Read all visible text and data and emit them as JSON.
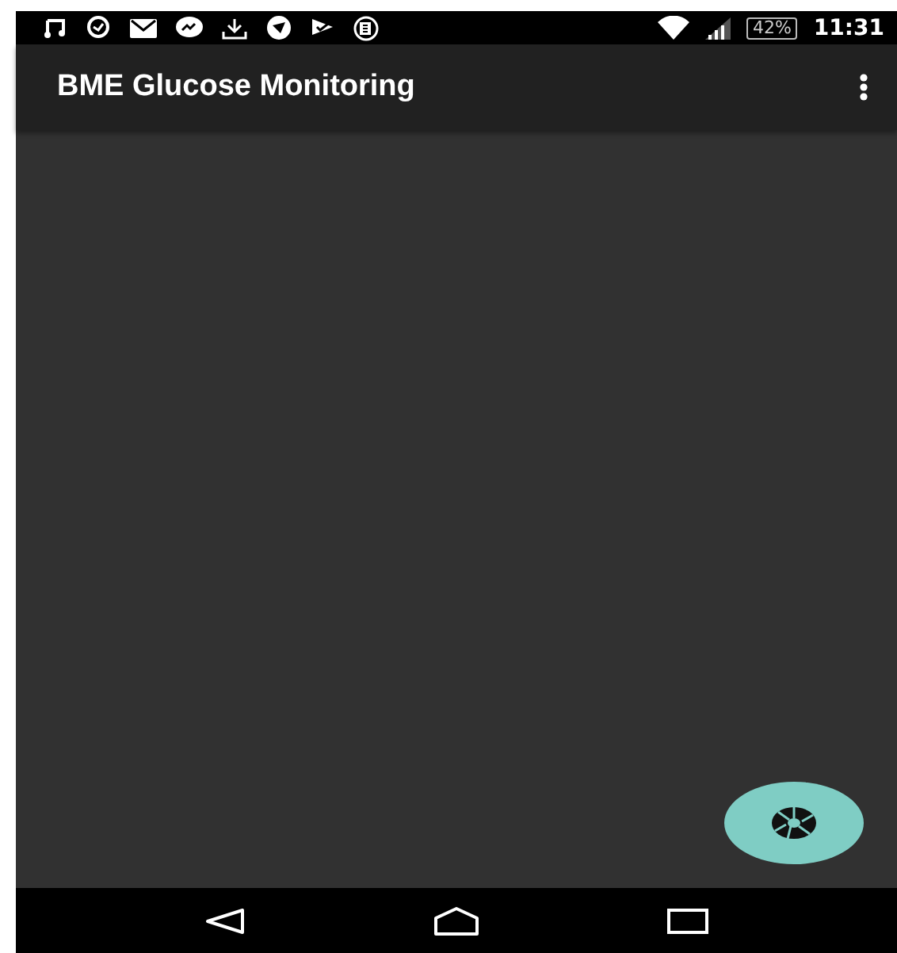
{
  "status_bar": {
    "battery": "42%",
    "time": "11:31"
  },
  "app_bar": {
    "title": "BME Glucose Monitoring"
  }
}
